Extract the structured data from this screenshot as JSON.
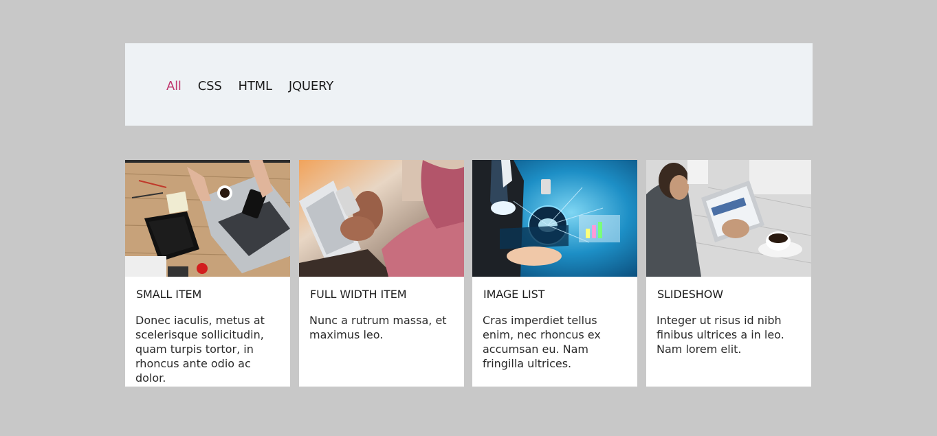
{
  "filters": [
    {
      "label": "All",
      "active": true
    },
    {
      "label": "CSS",
      "active": false
    },
    {
      "label": "HTML",
      "active": false
    },
    {
      "label": "JQUERY",
      "active": false
    }
  ],
  "accent_color": "#c0386f",
  "cards": [
    {
      "title": "SMALL ITEM",
      "description": "Donec iaculis, metus at scelerisque sollicitudin, quam turpis tortor, in rhoncus ante odio ac dolor.",
      "image": "workspace-desk-photo"
    },
    {
      "title": "FULL WIDTH ITEM",
      "description": "Nunc a rutrum massa, et maximus leo.",
      "image": "phone-laptop-photo"
    },
    {
      "title": "IMAGE LIST",
      "description": "Cras imperdiet tellus enim, nec rhoncus ex accumsan eu. Nam fringilla ultrices.",
      "image": "business-tech-photo"
    },
    {
      "title": "SLIDESHOW",
      "description": "Integer ut risus id nibh finibus ultrices a in leo. Nam lorem elit.",
      "image": "tablet-coffee-photo"
    }
  ]
}
